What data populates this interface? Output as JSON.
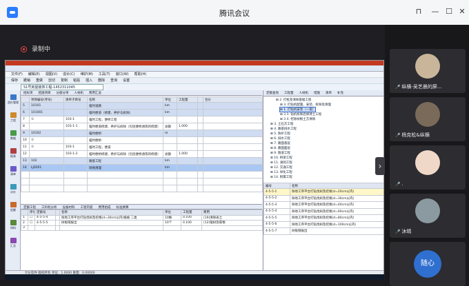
{
  "window": {
    "title": "腾讯会议"
  },
  "recording": {
    "label": "录制中"
  },
  "app": {
    "menus": [
      "文件(F)",
      "编辑(E)",
      "视图(V)",
      "造价(C)",
      "维护(M)",
      "工具(T)",
      "窗口(W)",
      "帮助(H)"
    ],
    "toolbar_items": [
      "保存",
      "撤销",
      "重做",
      "剪切",
      "复制",
      "粘贴",
      "插入",
      "删除",
      "查询",
      "设置"
    ],
    "file_tab": "S1号房屋装饰工程-1452311045",
    "left_icons": [
      "造价管理",
      "工程",
      "数据",
      "报表",
      "清单",
      "计价",
      "定额",
      "材料",
      "汇总"
    ],
    "main_tabs": [
      "招标项",
      "措施项目",
      "分部分项",
      "人材机",
      "费用汇总"
    ],
    "grid_headers": [
      "",
      "项目编号(序号)",
      "清单子目号",
      "名称",
      "单位",
      "工程量",
      "",
      "合价"
    ],
    "grid_rows": [
      {
        "c": [
          "5",
          "10101",
          "",
          "临时道路",
          "km",
          "",
          "",
          ""
        ],
        "cls": "hl"
      },
      {
        "c": [
          "6",
          "101001",
          "",
          "临时便道（修建、养护与拆除）",
          "km",
          "",
          "",
          ""
        ],
        "cls": "hl"
      },
      {
        "c": [
          "7",
          "①",
          "103-1",
          "临时工程，便桥工程",
          "",
          "",
          "",
          ""
        ],
        "cls": ""
      },
      {
        "c": [
          "8",
          "",
          "103-1-1",
          "临时便道修建、养护与拆除（包括便桥涵等的修建）",
          "总额",
          "1.000",
          "",
          ""
        ],
        "cls": ""
      },
      {
        "c": [
          "9",
          "10102",
          "",
          "临时便桥",
          "m",
          "",
          "",
          ""
        ],
        "cls": "hl"
      },
      {
        "c": [
          "10",
          "①",
          "",
          "临时便桥",
          "",
          "",
          "",
          ""
        ],
        "cls": ""
      },
      {
        "c": [
          "11",
          "①",
          "103-1",
          "临时工程，便道",
          "",
          "",
          "",
          ""
        ],
        "cls": ""
      },
      {
        "c": [
          "12",
          "",
          "103-1-2",
          "临时便桥修建、养护与拆除（包括便桥涵等的修建）",
          "总额",
          "1.000",
          "",
          ""
        ],
        "cls": ""
      },
      {
        "c": [
          "13",
          "102",
          "",
          "路基工程",
          "km",
          "",
          "",
          ""
        ],
        "cls": "hl"
      },
      {
        "c": [
          "14",
          "LJ0201",
          "",
          "场地清理",
          "km",
          "",
          "",
          ""
        ],
        "cls": "sel"
      }
    ],
    "bottom_tabs": [
      "定额工程",
      "工料机分析",
      "设备材料",
      "工程内容",
      "费用组成",
      "标准换算"
    ],
    "sub_headers": [
      "",
      "序号",
      "定额号",
      "",
      "名称",
      "单位",
      "工程量",
      "费用"
    ],
    "sub_rows": [
      {
        "c": [
          "1",
          "☐",
          "4-5-5-4",
          "",
          "除地工序平台打钻伐树及挖根(d=30cm以内)植被 二类",
          "10株",
          "0.100",
          "(19)清除表土"
        ]
      },
      {
        "c": [
          "2",
          "☐",
          "4-5-5-5",
          "",
          "树板缝拔出",
          "10个",
          "0.100",
          "(12)锯树及取根"
        ]
      },
      {
        "c": [
          "3",
          "",
          "",
          "",
          "",
          "",
          "",
          ""
        ]
      }
    ],
    "right_tabs": [
      "定额查询",
      "工程量",
      "人材机",
      "措施",
      "清单",
      "补充"
    ],
    "tree_nodes": [
      "2. 打桩及清除基础工程",
      "3. 打钻机配置、安装、拆除及清理",
      "1. 打钻机安装（一般）",
      "3 3. 钻机拆卸后保持土工程",
      "3 4. 挖除树根土方清除",
      "3. 土石方工程",
      "4. 路基排水工程",
      "5. 防护工程",
      "6. 排水工程",
      "7. 路面基层",
      "8. 路面面层",
      "9. 隧道工程",
      "10. 桥梁工程",
      "11. 涵洞工程",
      "12. 交通工程",
      "13. 绿化工程",
      "14. 附属工程"
    ],
    "rsub_headers": [
      "编号",
      "名称"
    ],
    "rsub_rows": [
      {
        "c": [
          "4-5-5-1",
          "除地工序平台打钻伐树及挖根(d=20cm以内)"
        ],
        "cls": "hl"
      },
      {
        "c": [
          "4-5-5-2",
          "除地工序平台打钻伐树及挖根(d=30cm以内)"
        ],
        "cls": ""
      },
      {
        "c": [
          "4-5-5-3",
          "除地工序平台打钻伐树及挖根(d=40cm以内)"
        ],
        "cls": ""
      },
      {
        "c": [
          "4-5-5-4",
          "除地工序平台打钻伐树及挖根(d=60cm以内)"
        ],
        "cls": ""
      },
      {
        "c": [
          "4-5-5-5",
          "除地工序平台打钻伐树及挖根(d=80cm以内)"
        ],
        "cls": ""
      },
      {
        "c": [
          "4-5-5-6",
          "除地工序平台打钻伐树及挖根(d=100cm以内)"
        ],
        "cls": ""
      },
      {
        "c": [
          "4-5-5-7",
          "树板缝拔出"
        ],
        "cls": ""
      }
    ],
    "status": "计价软件 版权所有   单位：1.0000   重量：0.00000"
  },
  "participants": [
    {
      "name": "纵横-吴艺晨的屏...",
      "color": "#c9b59a"
    },
    {
      "name": "杨克松&纵横",
      "color": "#7a6a5a"
    },
    {
      "name": ".",
      "color": "#f0d8c8"
    },
    {
      "name": "沐晴",
      "color": "#8a9aa0"
    },
    {
      "name": "随心",
      "color": "#2f6fd0"
    }
  ],
  "colors": {
    "accent": "#2b7dff",
    "record": "#e44444"
  }
}
